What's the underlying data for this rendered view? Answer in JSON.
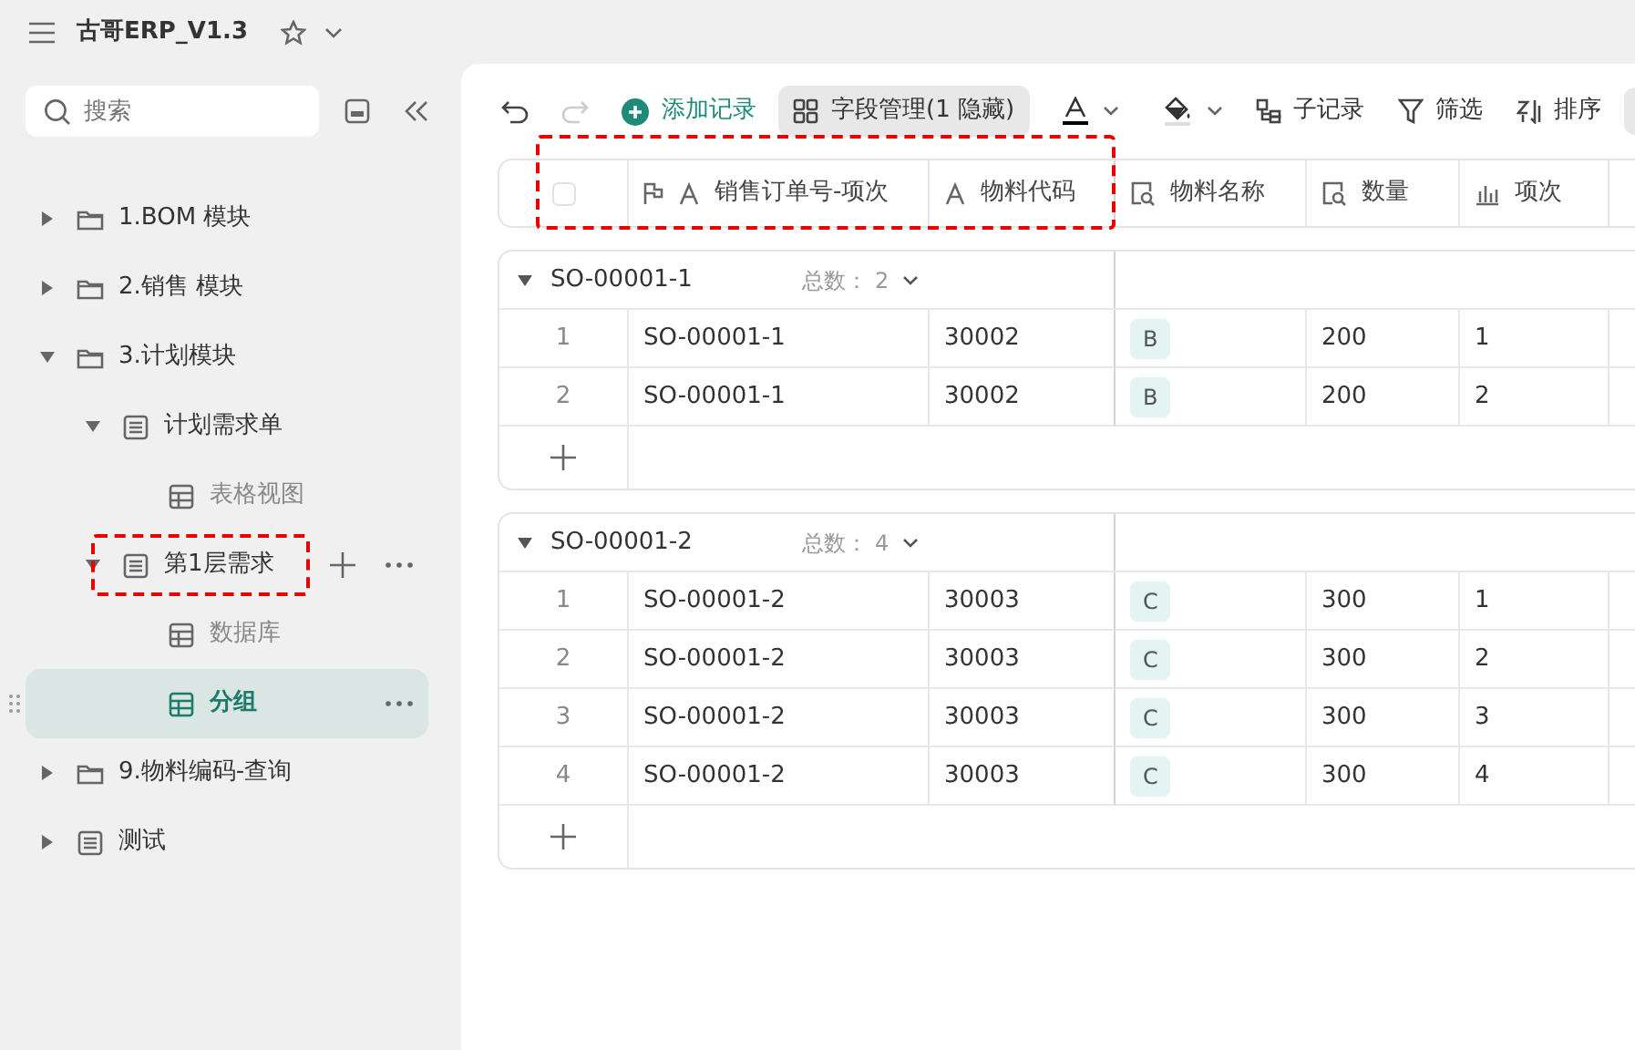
{
  "app": {
    "title": "古哥ERP_V1.3"
  },
  "sidebar": {
    "search": {
      "placeholder": "搜索"
    },
    "tree": [
      {
        "label": "1.BOM 模块",
        "kind": "folder",
        "expanded": false,
        "selected": false
      },
      {
        "label": "2.销售 模块",
        "kind": "folder",
        "expanded": false,
        "selected": false
      },
      {
        "label": "3.计划模块",
        "kind": "folder",
        "expanded": true,
        "selected": false,
        "children": [
          {
            "label": "计划需求单",
            "kind": "sheet",
            "expanded": true,
            "selected": false,
            "children": [
              {
                "label": "表格视图",
                "kind": "grid",
                "selected": false
              }
            ]
          },
          {
            "label": "第1层需求",
            "kind": "sheet",
            "expanded": true,
            "selected": false,
            "hovered": true,
            "highlighted": true,
            "children": [
              {
                "label": "数据库",
                "kind": "grid",
                "selected": false
              },
              {
                "label": "分组",
                "kind": "grid",
                "selected": true
              }
            ]
          }
        ]
      },
      {
        "label": "9.物料编码-查询",
        "kind": "folder",
        "expanded": false,
        "selected": false
      },
      {
        "label": "测试",
        "kind": "sheet",
        "expanded": false,
        "selected": false
      }
    ]
  },
  "toolbar": [
    {
      "kind": "undo",
      "disabled": false
    },
    {
      "kind": "redo",
      "disabled": true
    },
    {
      "kind": "add",
      "label": "添加记录",
      "selected": false
    },
    {
      "kind": "fields",
      "label": "字段管理(1 隐藏)",
      "selected": true
    },
    {
      "kind": "textcolor"
    },
    {
      "kind": "fillcolor"
    },
    {
      "kind": "subrecord",
      "label": "子记录",
      "selected": false
    },
    {
      "kind": "filter",
      "label": "筛选",
      "selected": false
    },
    {
      "kind": "sort",
      "label": "排序",
      "selected": false
    }
  ],
  "table": {
    "header_checkbox": {
      "checked": false,
      "highlighted": true
    },
    "columns": [
      {
        "label": "销售订单号-项次",
        "kind": "text",
        "primary": true,
        "highlighted": true
      },
      {
        "label": "物料代码",
        "kind": "text",
        "primary": false,
        "highlighted": true
      },
      {
        "label": "物料名称",
        "kind": "lookup",
        "primary": false,
        "highlighted": false
      },
      {
        "label": "数量",
        "kind": "lookup",
        "primary": false,
        "highlighted": false
      },
      {
        "label": "项次",
        "kind": "chart",
        "primary": false,
        "highlighted": false
      }
    ],
    "groups": [
      {
        "title": "SO-00001-1",
        "count_label": "总数：",
        "count": "2",
        "expanded": true,
        "rows": [
          {
            "index": "1",
            "cells": [
              "SO-00001-1",
              "30002",
              "B",
              "200",
              "1"
            ]
          },
          {
            "index": "2",
            "cells": [
              "SO-00001-1",
              "30002",
              "B",
              "200",
              "2"
            ]
          }
        ]
      },
      {
        "title": "SO-00001-2",
        "count_label": "总数：",
        "count": "4",
        "expanded": true,
        "rows": [
          {
            "index": "1",
            "cells": [
              "SO-00001-2",
              "30003",
              "C",
              "300",
              "1"
            ]
          },
          {
            "index": "2",
            "cells": [
              "SO-00001-2",
              "30003",
              "C",
              "300",
              "2"
            ]
          },
          {
            "index": "3",
            "cells": [
              "SO-00001-2",
              "30003",
              "C",
              "300",
              "3"
            ]
          },
          {
            "index": "4",
            "cells": [
              "SO-00001-2",
              "30003",
              "C",
              "300",
              "4"
            ]
          }
        ]
      }
    ]
  }
}
